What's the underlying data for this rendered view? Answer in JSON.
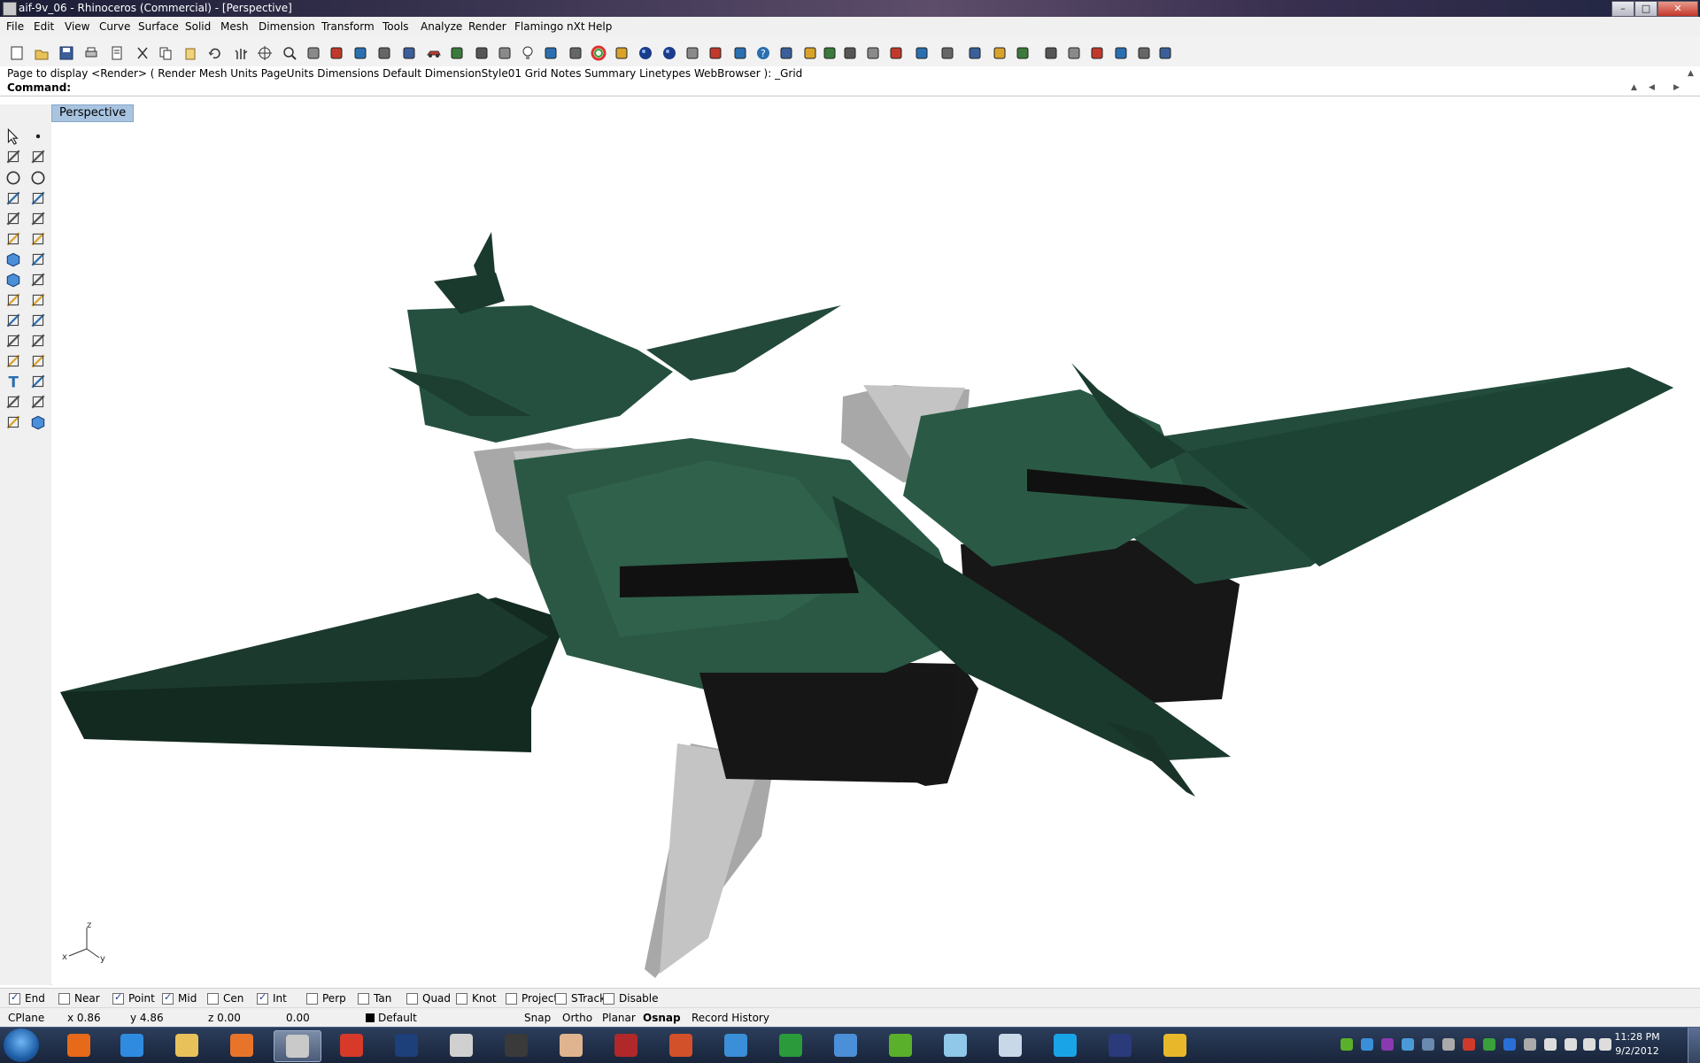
{
  "window": {
    "title": "aif-9v_06 - Rhinoceros (Commercial) - [Perspective]",
    "controls": [
      "minimize",
      "maximize",
      "close"
    ]
  },
  "menubar": {
    "items": [
      "File",
      "Edit",
      "View",
      "Curve",
      "Surface",
      "Solid",
      "Mesh",
      "Dimension",
      "Transform",
      "Tools",
      "Analyze",
      "Render",
      "Flamingo nXt",
      "Help"
    ]
  },
  "toolbar": {
    "icons": [
      "new-icon",
      "open-icon",
      "save-icon",
      "print-icon",
      "import-icon",
      "cut-icon",
      "copy-icon",
      "paste-icon",
      "undo-icon",
      "pan-icon",
      "rotate-view-icon",
      "zoom-icon",
      "zoom-window-icon",
      "zoom-extents-icon",
      "zoom-selected-icon",
      "rotate-icon",
      "four-viewports-icon",
      "car-icon",
      "grid-snap-icon",
      "cplane-icon",
      "osnap-icon",
      "light-icon",
      "lock-icon",
      "render-icon",
      "color-wheel-icon",
      "wireframe-icon",
      "shaded-icon",
      "rendered-icon",
      "pen-icon",
      "gear-icon",
      "dimension-icon",
      "help-icon",
      "solid-box-icon",
      "move-icon",
      "points-icon",
      "layer-icon",
      "array-icon",
      "group-icon",
      "curve-tool-icon",
      "mesh-icon",
      "edit-icon",
      "blend-icon",
      "loft-icon",
      "patch-icon",
      "section-icon",
      "split-icon",
      "extend-icon",
      "trim-icon",
      "network-icon"
    ]
  },
  "command_history": {
    "text": "Page to display <Render> ( Render  Mesh  Units  PageUnits  Dimensions  Default  DimensionStyle01  Grid  Notes  Summary  Linetypes  WebBrowser ): _Grid"
  },
  "command_line": {
    "label": "Command:",
    "value": ""
  },
  "viewport": {
    "label": "Perspective",
    "axis": {
      "x": "x",
      "y": "y",
      "z": "z"
    },
    "model_colors": {
      "hull": "#1f4435",
      "hull_light": "#2a5a45",
      "hull_dark": "#132a20",
      "shadow": "#171717",
      "grey": "#a8a8a8",
      "grey_light": "#c4c4c4"
    }
  },
  "osnap": {
    "items": [
      {
        "label": "End",
        "checked": true
      },
      {
        "label": "Near",
        "checked": false
      },
      {
        "label": "Point",
        "checked": true
      },
      {
        "label": "Mid",
        "checked": true
      },
      {
        "label": "Cen",
        "checked": false
      },
      {
        "label": "Int",
        "checked": true
      },
      {
        "label": "Perp",
        "checked": false
      },
      {
        "label": "Tan",
        "checked": false
      },
      {
        "label": "Quad",
        "checked": false
      },
      {
        "label": "Knot",
        "checked": false
      },
      {
        "label": "Project",
        "checked": false
      },
      {
        "label": "STrack",
        "checked": false
      },
      {
        "label": "Disable",
        "checked": false
      }
    ]
  },
  "status": {
    "cplane": "CPlane",
    "x": "x 0.86",
    "y": "y 4.86",
    "z": "z 0.00",
    "distance": "0.00",
    "layer": "Default",
    "layer_color": "#000000",
    "snap": "Snap",
    "ortho": "Ortho",
    "planar": "Planar",
    "osnap": "Osnap",
    "record_history": "Record History"
  },
  "taskbar": {
    "apps": [
      {
        "name": "firefox-icon",
        "color": "#e66a1a",
        "active": false
      },
      {
        "name": "internet-explorer-icon",
        "color": "#2f8be0",
        "active": false
      },
      {
        "name": "folder-icon",
        "color": "#e8c15a",
        "active": false
      },
      {
        "name": "media-player-icon",
        "color": "#e8742a",
        "active": false
      },
      {
        "name": "rhino-icon",
        "color": "#c9c9c9",
        "active": true
      },
      {
        "name": "sketchup-icon",
        "color": "#d83a2a",
        "active": false
      },
      {
        "name": "photoshop-icon",
        "color": "#1d3f7a",
        "active": false
      },
      {
        "name": "zbrush-icon",
        "color": "#d0d0d0",
        "active": false
      },
      {
        "name": "steam-icon",
        "color": "#3a3a3a",
        "active": false
      },
      {
        "name": "hand-tool-icon",
        "color": "#e0b48e",
        "active": false
      },
      {
        "name": "app-red-icon",
        "color": "#b0282a",
        "active": false
      },
      {
        "name": "powerpoint-icon",
        "color": "#d2502a",
        "active": false
      },
      {
        "name": "messenger-icon",
        "color": "#3a8fd8",
        "active": false
      },
      {
        "name": "green-arrow-icon",
        "color": "#2a9a3a",
        "active": false
      },
      {
        "name": "colored-cubes-icon",
        "color": "#4a8fd8",
        "active": false
      },
      {
        "name": "dreamweaver-icon",
        "color": "#5ab02a",
        "active": false
      },
      {
        "name": "notepad-icon",
        "color": "#8fc8e8",
        "active": false
      },
      {
        "name": "calculator-icon",
        "color": "#c8d8e8",
        "active": false
      },
      {
        "name": "skype-icon",
        "color": "#1aa4e8",
        "active": false
      },
      {
        "name": "eye-icon",
        "color": "#2a3a7a",
        "active": false
      },
      {
        "name": "notes-icon",
        "color": "#e8b82a",
        "active": false
      }
    ],
    "tray_icons": [
      "green-leaf-icon",
      "globe-icon",
      "onenote-icon",
      "network-icon",
      "monitor-icon",
      "speaker-mini-icon",
      "red-circle-icon",
      "green-circle-icon",
      "bluetooth-icon",
      "gear-tray-icon",
      "flag-icon",
      "display-icon",
      "signal-icon",
      "volume-icon"
    ],
    "clock_time": "11:28 PM",
    "clock_date": "9/2/2012"
  }
}
